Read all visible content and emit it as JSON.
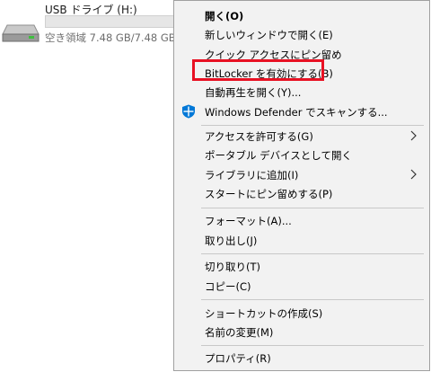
{
  "drive": {
    "name": "USB ドライブ (H:)",
    "space": "空き領域 7.48 GB/7.48 GB",
    "used_fraction": 0.0,
    "icon": "usb-drive-icon"
  },
  "menu": {
    "open": "開く(O)",
    "open_new_window": "新しいウィンドウで開く(E)",
    "pin_quick_access": "クイック アクセスにピン留め",
    "bitlocker": "BitLocker を有効にする(B)",
    "autoplay": "自動再生を開く(Y)...",
    "defender": "Windows Defender でスキャンする...",
    "give_access": "アクセスを許可する(G)",
    "portable_device": "ポータブル デバイスとして開く",
    "add_library": "ライブラリに追加(I)",
    "pin_start": "スタートにピン留めする(P)",
    "format": "フォーマット(A)...",
    "eject": "取り出し(J)",
    "cut": "切り取り(T)",
    "copy": "コピー(C)",
    "shortcut": "ショートカットの作成(S)",
    "rename": "名前の変更(M)",
    "properties": "プロパティ(R)"
  },
  "colors": {
    "highlight_border": "#e81123",
    "menu_background": "#f2f2f2",
    "defender_blue": "#0078d7"
  }
}
